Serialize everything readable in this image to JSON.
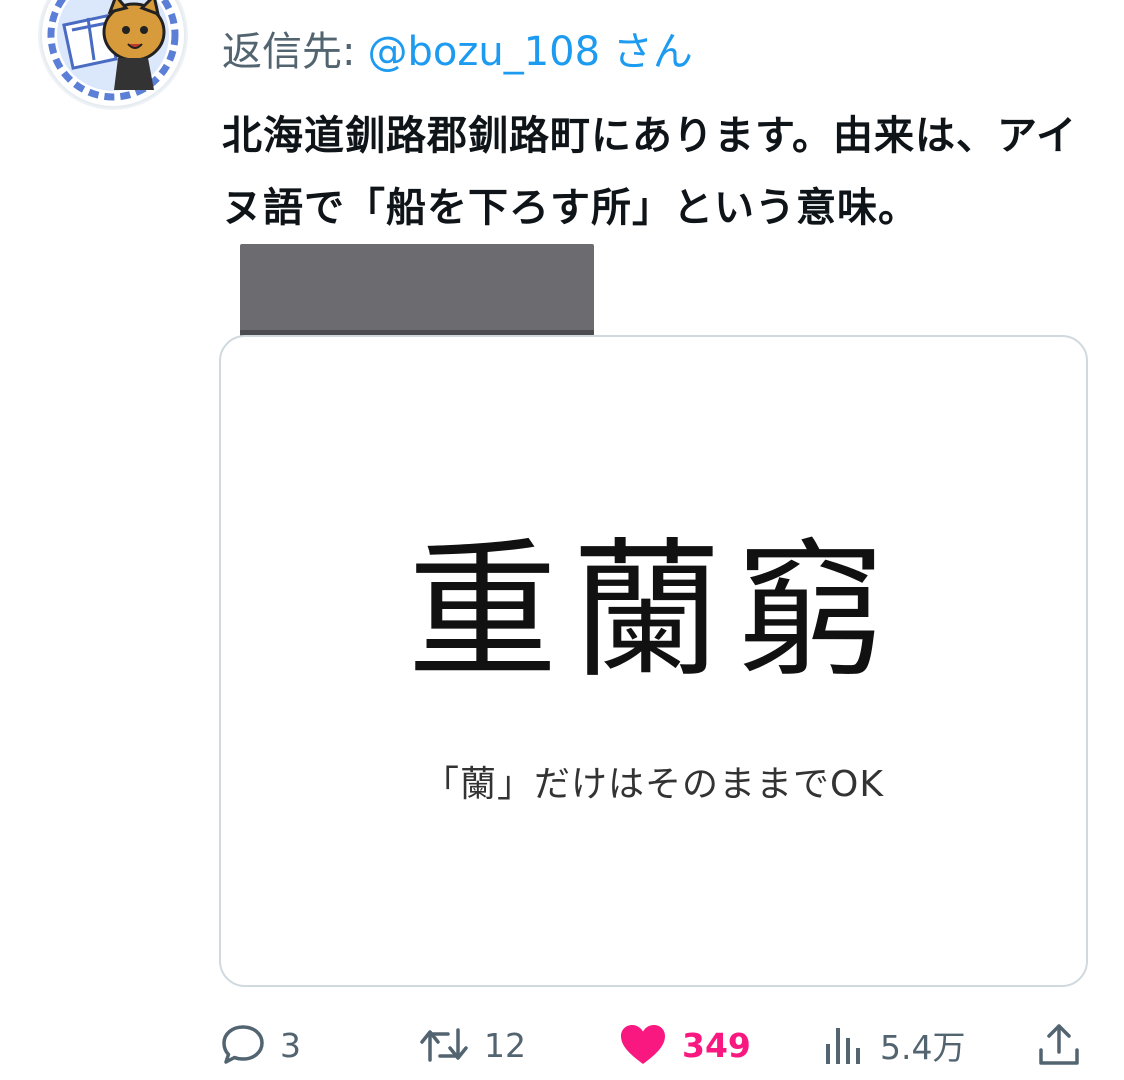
{
  "reply": {
    "prefix": "返信先:",
    "handle": "@bozu_108 さん"
  },
  "tweet": {
    "text": "北海道釧路郡釧路町にあります。由来は、アイヌ語で「船を下ろす所」という意味。"
  },
  "media": {
    "main_text": "重蘭窮",
    "caption": "「蘭」だけはそのままでOK"
  },
  "actions": {
    "reply_count": "3",
    "retweet_count": "12",
    "like_count": "349",
    "views_count": "5.4万"
  },
  "colors": {
    "accent": "#1d9bf0",
    "like": "#f91880",
    "muted": "#536471",
    "border": "#cfd9de"
  },
  "icons": [
    "reply-icon",
    "retweet-icon",
    "heart-icon",
    "views-icon",
    "share-icon"
  ]
}
